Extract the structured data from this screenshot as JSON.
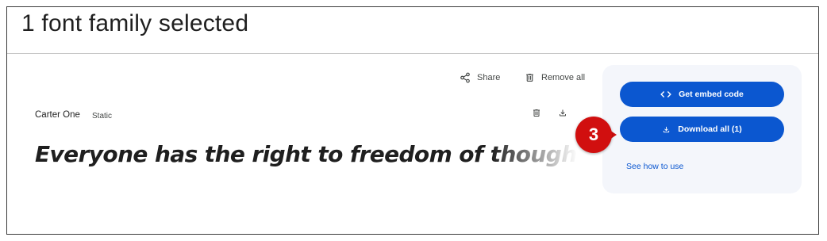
{
  "header": {
    "title": "1 font family selected"
  },
  "toolbar": {
    "share_label": "Share",
    "share_icon": "share-icon",
    "remove_label": "Remove all",
    "remove_icon": "trash-icon"
  },
  "font_item": {
    "name": "Carter One",
    "style": "Static",
    "sample_text": "Everyone has the right to freedom of thought, conscience and religion",
    "actions": [
      "trash-icon",
      "download-icon"
    ]
  },
  "panel": {
    "embed_label": "Get embed code",
    "embed_icon": "code-icon",
    "download_label": "Download all (1)",
    "download_icon": "download-icon",
    "howto_label": "See how to use"
  },
  "annotation": {
    "step": "3",
    "color": "#d10f0f"
  },
  "colors": {
    "accent": "#0b57d0",
    "panel_bg": "#f4f6fb",
    "text": "#1f1f1f"
  }
}
